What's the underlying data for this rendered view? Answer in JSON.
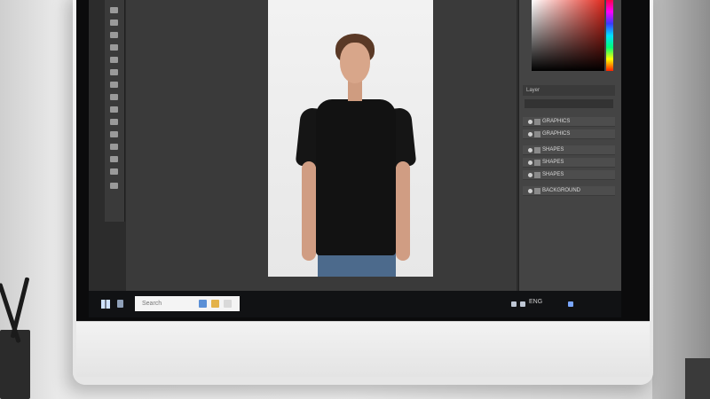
{
  "scene": {
    "description_subject": "desktop monitor showing photo editing application",
    "colors": {
      "screen_bg": "#2c2c2c",
      "shirt": "#121212",
      "taskbar": "#111214"
    }
  },
  "app": {
    "panels": {
      "layers_header": "Layer",
      "layers": [
        {
          "label": "GRAPHICS"
        },
        {
          "label": "GRAPHICS"
        },
        {
          "label": "SHAPES"
        },
        {
          "label": "SHAPES"
        },
        {
          "label": "SHAPES"
        },
        {
          "label": "BACKGROUND"
        }
      ]
    }
  },
  "taskbar": {
    "search_placeholder": "Search",
    "tray_text": "ENG",
    "icons": [
      "start-icon",
      "back-icon",
      "folder-icon",
      "browser-icon",
      "mail-icon"
    ]
  }
}
